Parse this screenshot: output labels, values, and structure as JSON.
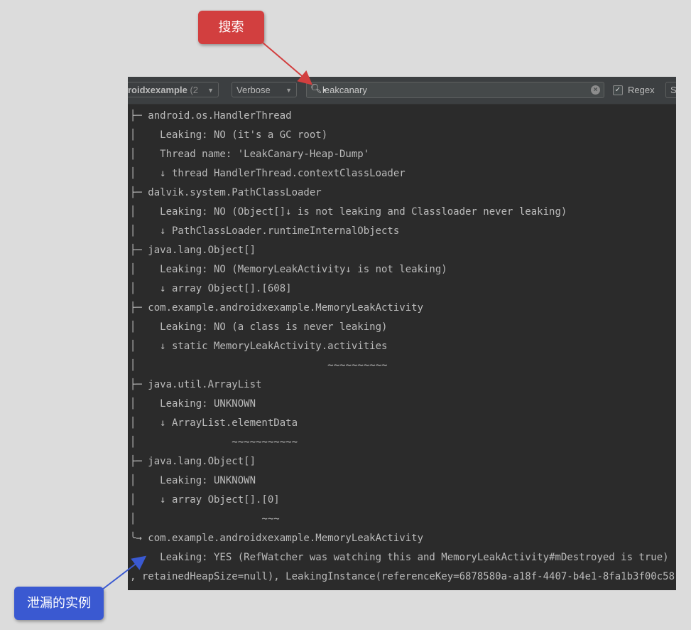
{
  "toolbar": {
    "process": "roidxexample",
    "process_suffix": "(2",
    "log_level": "Verbose",
    "search_value": "leakcanary",
    "regex_label": "Regex",
    "regex_checked": true,
    "more_label": "S"
  },
  "log_lines": [
    "├─ android.os.HandlerThread",
    "│    Leaking: NO (it's a GC root)",
    "│    Thread name: 'LeakCanary-Heap-Dump'",
    "│    ↓ thread HandlerThread.contextClassLoader",
    "├─ dalvik.system.PathClassLoader",
    "│    Leaking: NO (Object[]↓ is not leaking and Classloader never leaking)",
    "│    ↓ PathClassLoader.runtimeInternalObjects",
    "├─ java.lang.Object[]",
    "│    Leaking: NO (MemoryLeakActivity↓ is not leaking)",
    "│    ↓ array Object[].[608]",
    "├─ com.example.androidxexample.MemoryLeakActivity",
    "│    Leaking: NO (a class is never leaking)",
    "│    ↓ static MemoryLeakActivity.activities",
    "│                                ~~~~~~~~~~",
    "├─ java.util.ArrayList",
    "│    Leaking: UNKNOWN",
    "│    ↓ ArrayList.elementData",
    "│                ~~~~~~~~~~~",
    "├─ java.lang.Object[]",
    "│    Leaking: UNKNOWN",
    "│    ↓ array Object[].[0]",
    "│                     ~~~",
    "╰→ com.example.androidxexample.MemoryLeakActivity",
    "     Leaking: YES (RefWatcher was watching this and MemoryLeakActivity#mDestroyed is true)",
    ", retainedHeapSize=null), LeakingInstance(referenceKey=6878580a-a18f-4407-b4e1-8fa1b3f00c58"
  ],
  "annotations": {
    "search": "搜索",
    "leaked_instance": "泄漏的实例"
  },
  "colors": {
    "search_callout": "#d23f3f",
    "leak_callout": "#3a59d1",
    "log_background": "#2b2b2b",
    "toolbar_background": "#3c3f41"
  }
}
